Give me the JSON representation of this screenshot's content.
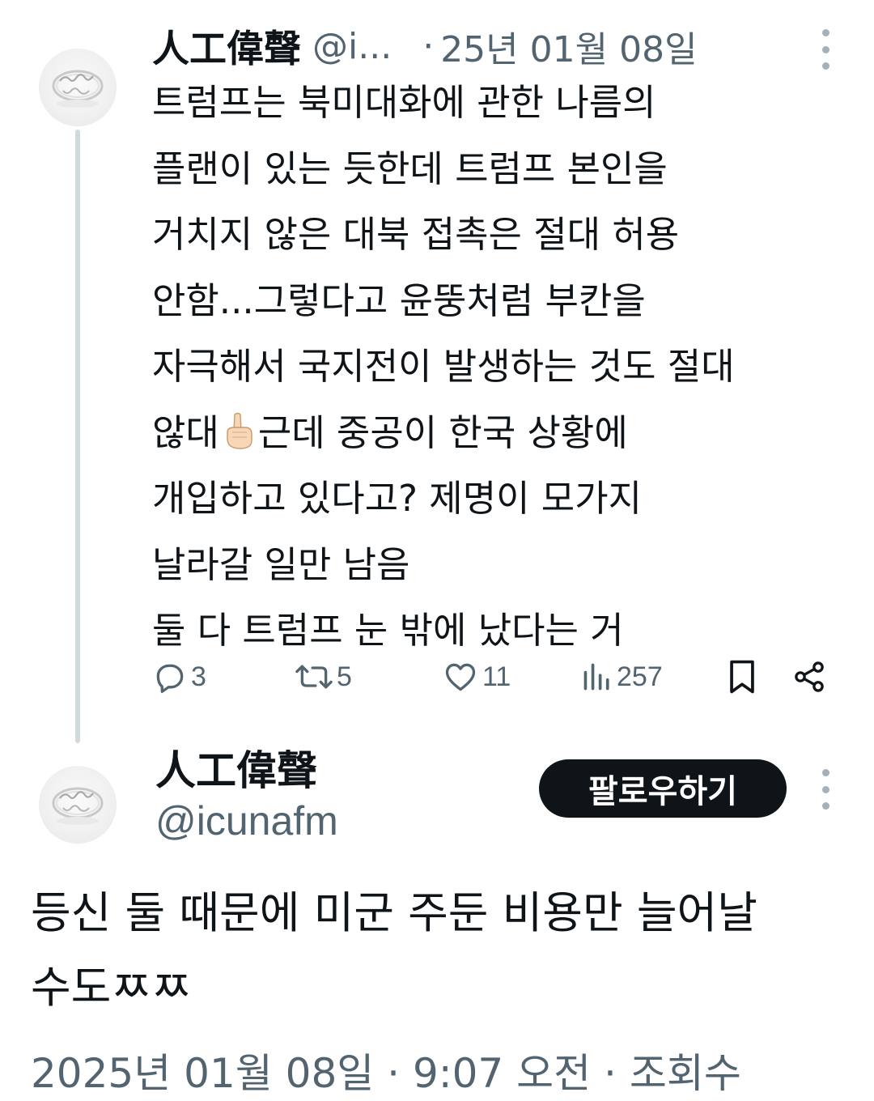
{
  "tweet1": {
    "name": "人工偉聲",
    "handle_short": "@i...",
    "separator": "·",
    "date": "25년 01월 08일",
    "lines": [
      "트럼프는 북미대화에 관한 나름의",
      "플랜이 있는 듯한데 트럼프 본인을",
      "거치지 않은 대북 접촉은 절대 허용",
      "안함...그렇다고 윤뚱처럼 부칸을",
      "자극해서 국지전이 발생하는 것도 절대"
    ],
    "line6_before_emoji": "않대",
    "emoji": "pointing-up-emoji",
    "line6_after_emoji": "근데 중공이 한국 상황에",
    "lines_after": [
      "개입하고 있다고? 제명이 모가지",
      "날라갈 일만 남음",
      "둘 다 트럼프 눈 밖에 났다는 거"
    ],
    "stats": {
      "replies": "3",
      "retweets": "5",
      "likes": "11",
      "views": "257"
    },
    "icons": {
      "reply": "reply-icon",
      "retweet": "retweet-icon",
      "like": "heart-icon",
      "views": "views-icon",
      "bookmark": "bookmark-icon",
      "share": "share-icon",
      "more": "more-vertical-icon"
    }
  },
  "tweet2": {
    "name": "人工偉聲",
    "handle": "@icunafm",
    "follow_label": "팔로우하기",
    "lines": [
      "등신 둘 때문에 미군 주둔 비용만 늘어날",
      "수도ㅉㅉ"
    ],
    "meta": "2025년 01월 08일 · 9:07 오전 · 조회수"
  },
  "colors": {
    "text": "#0f1419",
    "secondary": "#536471",
    "thread_line": "#cfd9de",
    "follow_bg": "#0f1419",
    "follow_text": "#ffffff"
  }
}
